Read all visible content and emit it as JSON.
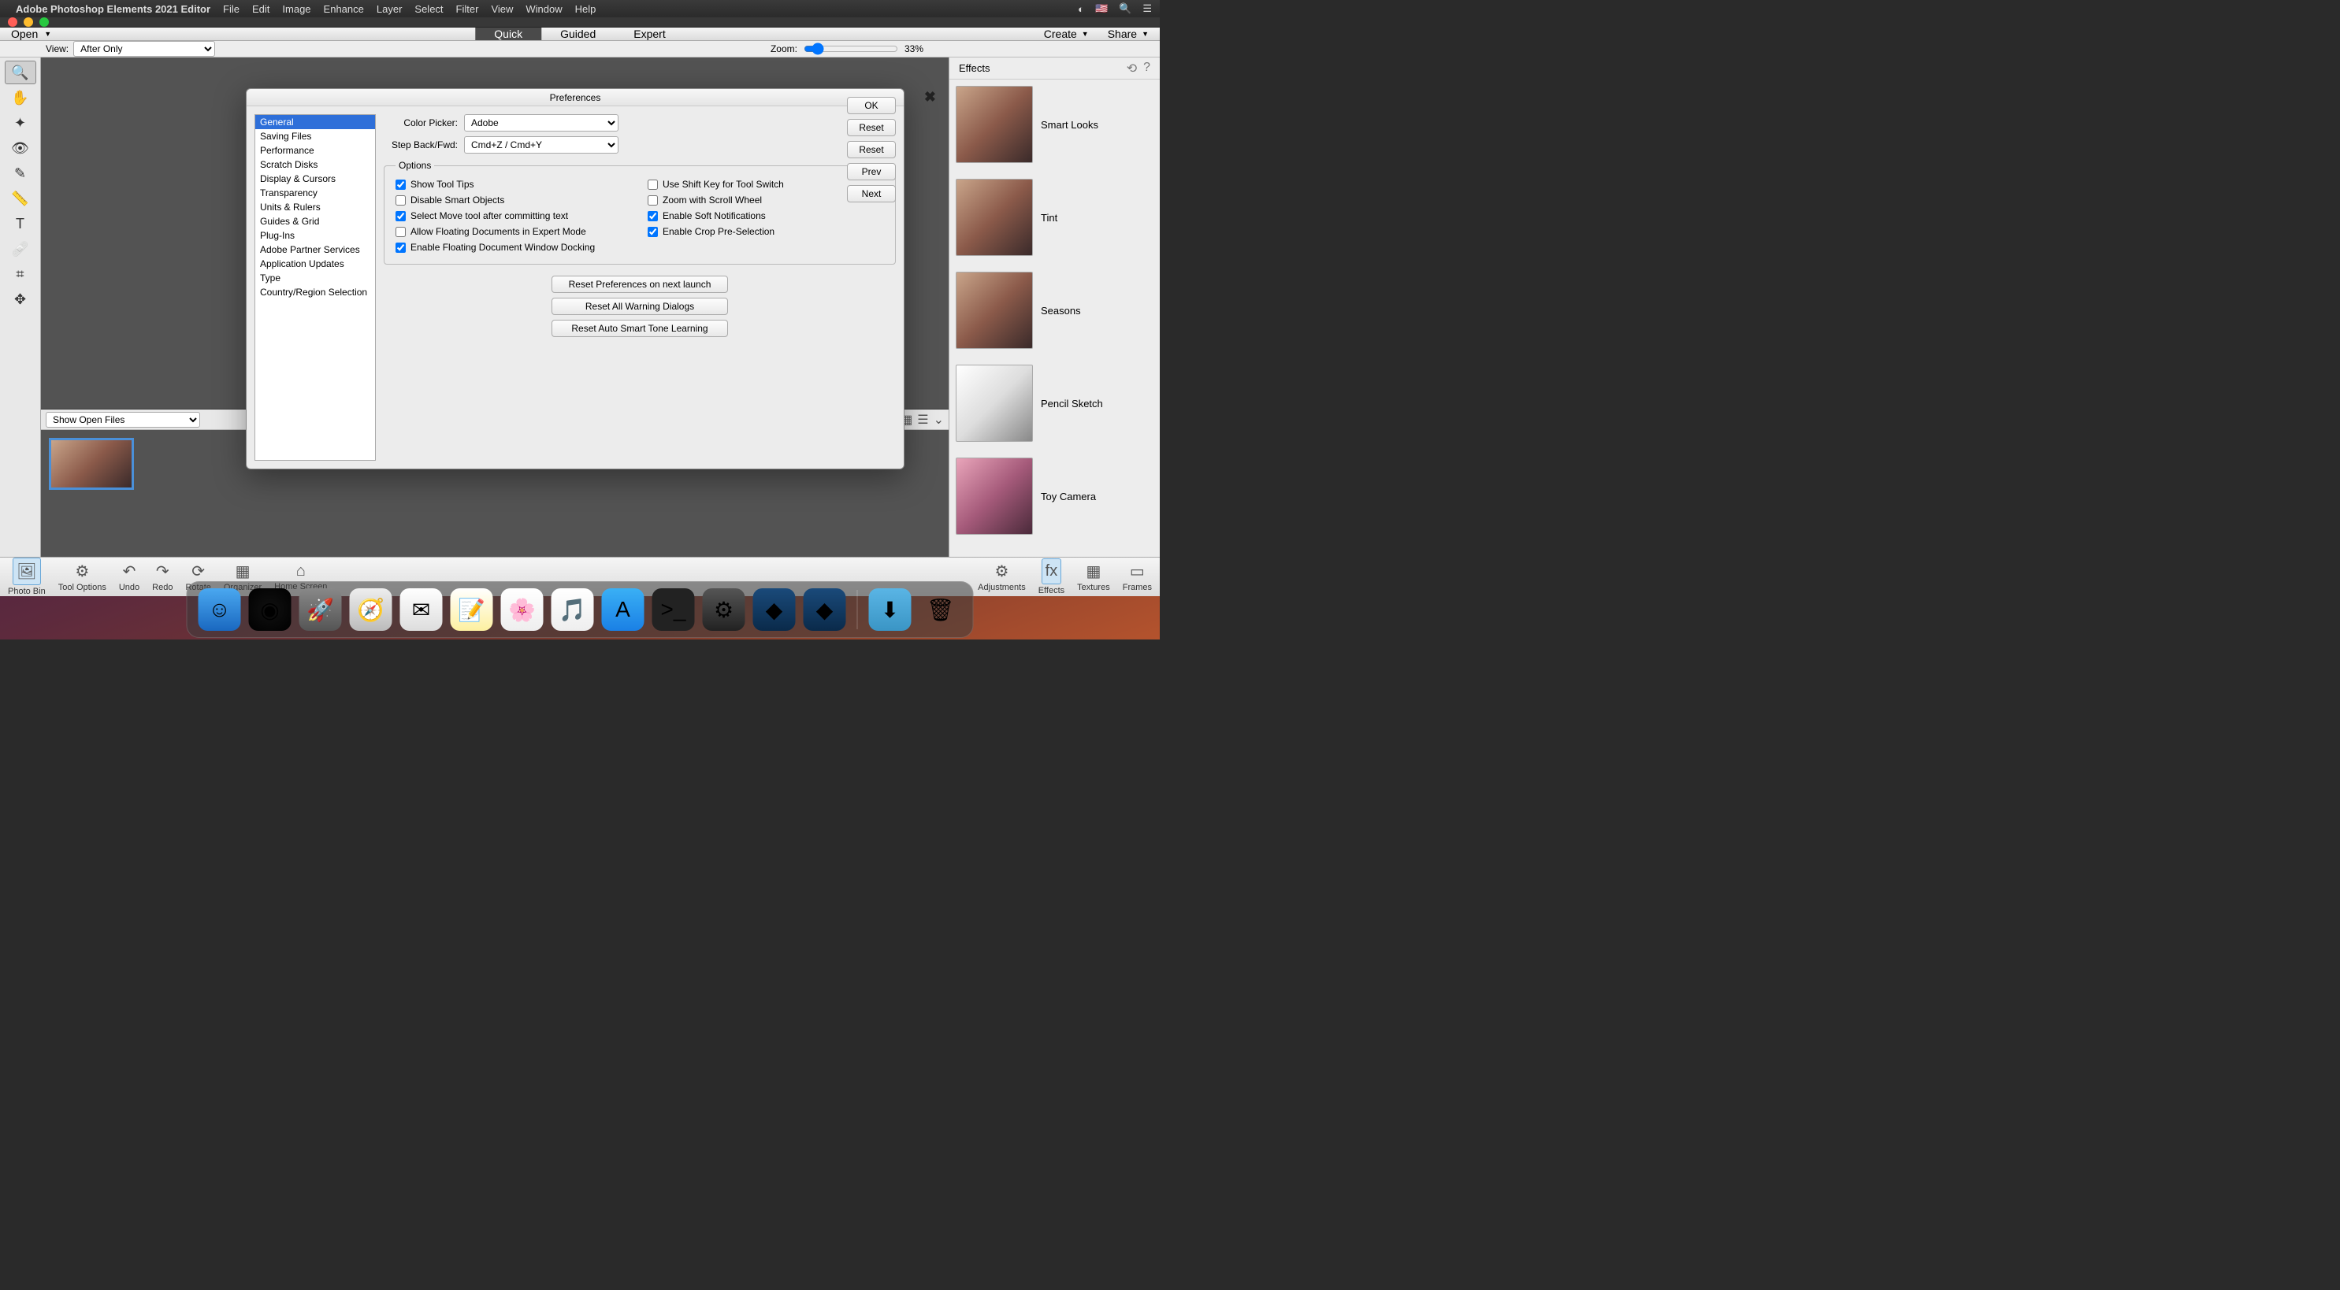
{
  "mac_menubar": {
    "app_name": "Adobe Photoshop Elements 2021 Editor",
    "menus": [
      "File",
      "Edit",
      "Image",
      "Enhance",
      "Layer",
      "Select",
      "Filter",
      "View",
      "Window",
      "Help"
    ]
  },
  "top_toolbar": {
    "open_label": "Open",
    "modes": [
      {
        "label": "Quick",
        "active": true
      },
      {
        "label": "Guided",
        "active": false
      },
      {
        "label": "Expert",
        "active": false
      }
    ],
    "create_label": "Create",
    "share_label": "Share"
  },
  "options_bar": {
    "view_label": "View:",
    "view_value": "After Only",
    "zoom_label": "Zoom:",
    "zoom_value": "33%"
  },
  "effects_panel": {
    "title": "Effects",
    "items": [
      {
        "label": "Smart Looks",
        "variant": "normal"
      },
      {
        "label": "Tint",
        "variant": "normal"
      },
      {
        "label": "Seasons",
        "variant": "normal"
      },
      {
        "label": "Pencil Sketch",
        "variant": "pencil"
      },
      {
        "label": "Toy Camera",
        "variant": "toy"
      }
    ]
  },
  "photo_bin": {
    "dropdown_value": "Show Open Files"
  },
  "bottom_bar": {
    "items_left": [
      {
        "label": "Photo Bin",
        "icon": "🖼",
        "active": true
      },
      {
        "label": "Tool Options",
        "icon": "⚙"
      },
      {
        "label": "Undo",
        "icon": "↶"
      },
      {
        "label": "Redo",
        "icon": "↷"
      },
      {
        "label": "Rotate",
        "icon": "⟳"
      },
      {
        "label": "Organizer",
        "icon": "▦"
      },
      {
        "label": "Home Screen",
        "icon": "⌂"
      }
    ],
    "items_right": [
      {
        "label": "Adjustments",
        "icon": "⚙"
      },
      {
        "label": "Effects",
        "icon": "fx",
        "active": true
      },
      {
        "label": "Textures",
        "icon": "▦"
      },
      {
        "label": "Frames",
        "icon": "▭"
      }
    ]
  },
  "prefs": {
    "title": "Preferences",
    "categories": [
      "General",
      "Saving Files",
      "Performance",
      "Scratch Disks",
      "Display & Cursors",
      "Transparency",
      "Units & Rulers",
      "Guides & Grid",
      "Plug-Ins",
      "Adobe Partner Services",
      "Application Updates",
      "Type",
      "Country/Region Selection"
    ],
    "selected_category": "General",
    "color_picker_label": "Color Picker:",
    "color_picker_value": "Adobe",
    "step_label": "Step Back/Fwd:",
    "step_value": "Cmd+Z / Cmd+Y",
    "options_legend": "Options",
    "checkboxes": [
      {
        "label": "Show Tool Tips",
        "checked": true
      },
      {
        "label": "Use Shift Key for Tool Switch",
        "checked": false
      },
      {
        "label": "Disable Smart Objects",
        "checked": false
      },
      {
        "label": "Zoom with Scroll Wheel",
        "checked": false
      },
      {
        "label": "Select Move tool after committing text",
        "checked": true
      },
      {
        "label": "Enable Soft Notifications",
        "checked": true
      },
      {
        "label": "Allow Floating Documents in Expert Mode",
        "checked": false
      },
      {
        "label": "Enable Crop Pre-Selection",
        "checked": true
      },
      {
        "label": "Enable Floating Document Window Docking",
        "checked": true
      }
    ],
    "reset_buttons": [
      "Reset Preferences on next launch",
      "Reset All Warning Dialogs",
      "Reset Auto Smart Tone Learning"
    ],
    "side_buttons": [
      "OK",
      "Reset",
      "Reset",
      "Prev",
      "Next"
    ]
  },
  "tools": [
    "zoom",
    "hand",
    "quick-select",
    "eye",
    "whiten",
    "straighten",
    "text",
    "spot-heal",
    "crop",
    "move"
  ],
  "tool_icons": {
    "zoom": "🔍",
    "hand": "✋",
    "quick-select": "✦",
    "eye": "👁",
    "whiten": "✎",
    "straighten": "📏",
    "text": "T",
    "spot-heal": "🩹",
    "crop": "⌗",
    "move": "✥"
  },
  "dock": {
    "items": [
      {
        "name": "finder",
        "bg": "linear-gradient(#4aa8f0,#1a68c0)",
        "glyph": "☺"
      },
      {
        "name": "siri",
        "bg": "radial-gradient(circle,#111,#000)",
        "glyph": "◉"
      },
      {
        "name": "launchpad",
        "bg": "linear-gradient(#888,#555)",
        "glyph": "🚀"
      },
      {
        "name": "safari",
        "bg": "linear-gradient(#eee,#bbb)",
        "glyph": "🧭"
      },
      {
        "name": "mail",
        "bg": "linear-gradient(#fff,#ddd)",
        "glyph": "✉"
      },
      {
        "name": "notes",
        "bg": "linear-gradient(#fff,#fdf0a0)",
        "glyph": "📝"
      },
      {
        "name": "photos",
        "bg": "linear-gradient(#fff,#eee)",
        "glyph": "🌸"
      },
      {
        "name": "music",
        "bg": "linear-gradient(#fff,#eee)",
        "glyph": "🎵"
      },
      {
        "name": "appstore",
        "bg": "linear-gradient(#3ab0f5,#1a80e5)",
        "glyph": "A"
      },
      {
        "name": "terminal",
        "bg": "#222",
        "glyph": ">_"
      },
      {
        "name": "settings",
        "bg": "linear-gradient(#555,#222)",
        "glyph": "⚙"
      },
      {
        "name": "pse-1",
        "bg": "linear-gradient(#1a4a7a,#0a2a4a)",
        "glyph": "◆"
      },
      {
        "name": "pse-2",
        "bg": "linear-gradient(#1a4a7a,#0a2a4a)",
        "glyph": "◆"
      }
    ],
    "right_items": [
      {
        "name": "downloads",
        "bg": "linear-gradient(#5ab5e5,#3a95c5)",
        "glyph": "⬇"
      },
      {
        "name": "trash",
        "bg": "transparent",
        "glyph": "🗑"
      }
    ]
  }
}
